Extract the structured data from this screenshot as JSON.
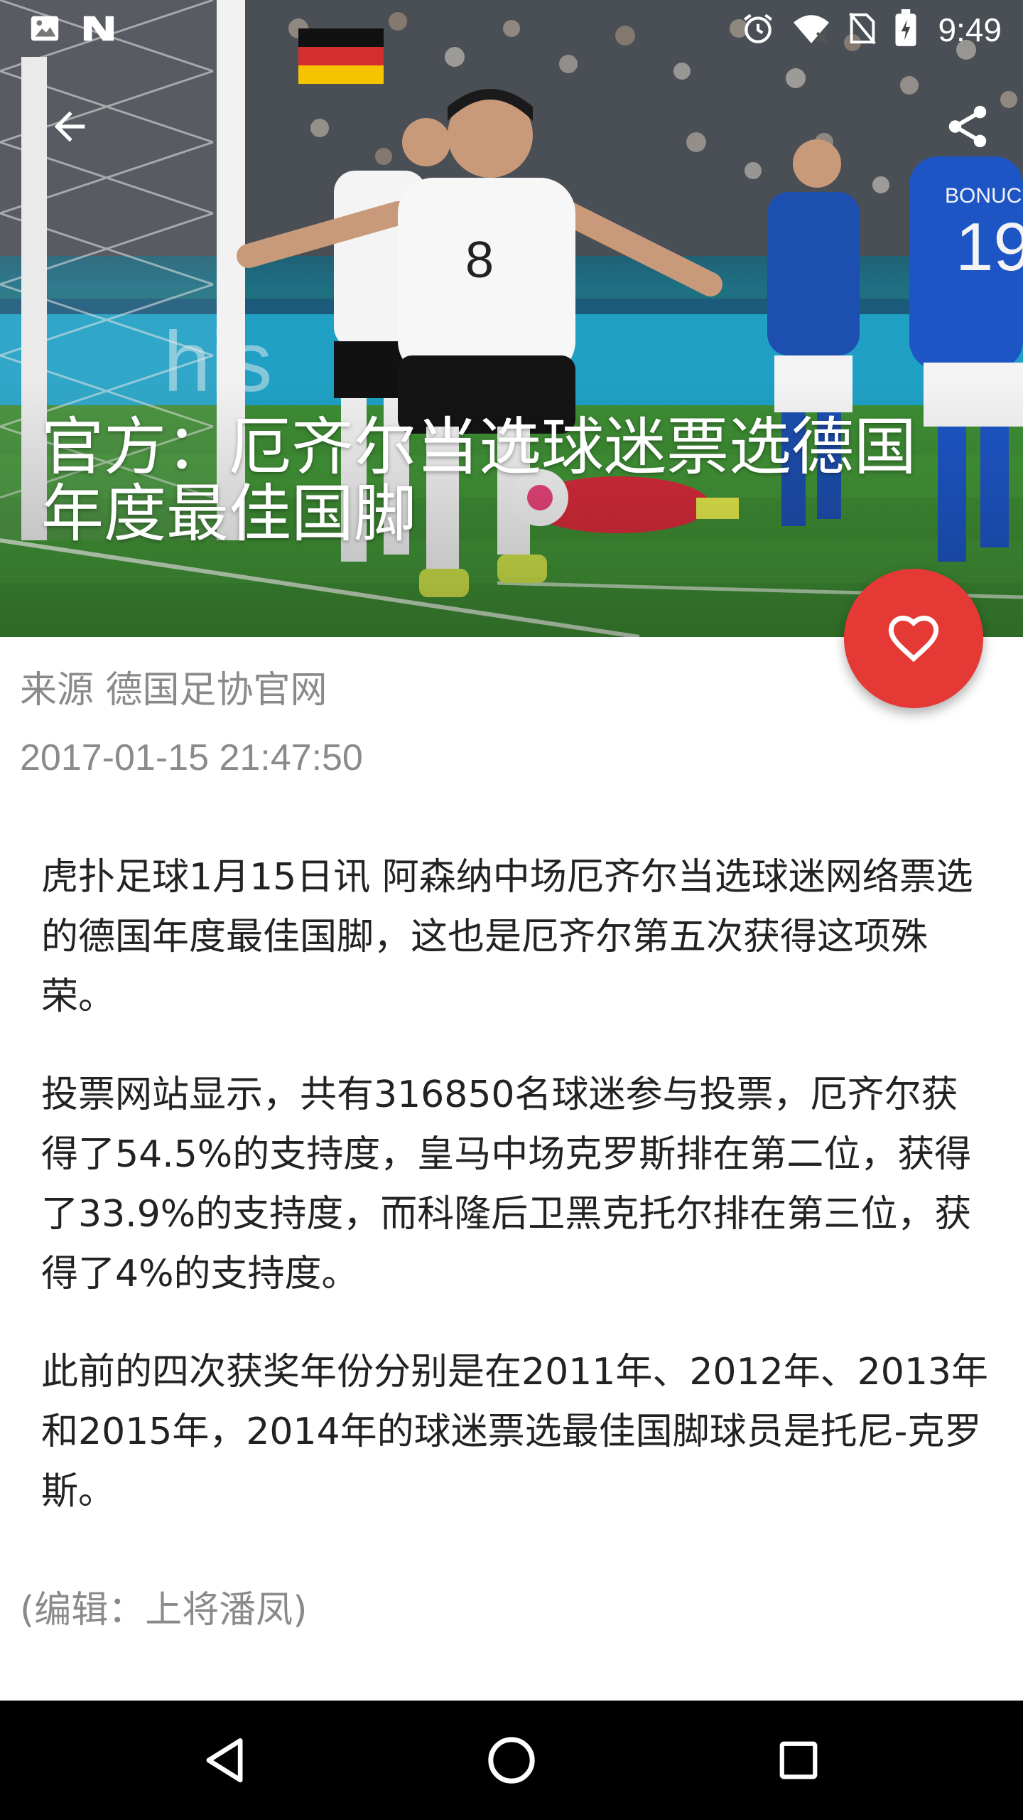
{
  "status_bar": {
    "time": "9:49",
    "left_icons": [
      "image-icon",
      "n-notification-icon"
    ],
    "right_icons": [
      "alarm-icon",
      "wifi-icon",
      "no-sim-icon",
      "battery-charging-icon"
    ]
  },
  "toolbar": {
    "back_icon": "arrow-back-icon",
    "share_icon": "share-icon"
  },
  "article": {
    "title": "官方：厄齐尔当选球迷票选德国年度最佳国脚",
    "source": "来源 德国足协官网",
    "datetime": "2017-01-15 21:47:50",
    "paragraphs": [
      "虎扑足球1月15日讯 阿森纳中场厄齐尔当选球迷网络票选的德国年度最佳国脚，这也是厄齐尔第五次获得这项殊荣。",
      "投票网站显示，共有316850名球迷参与投票，厄齐尔获得了54.5%的支持度，皇马中场克罗斯排在第二位，获得了33.9%的支持度，而科隆后卫黑克托尔排在第三位，获得了4%的支持度。",
      "此前的四次获奖年份分别是在2011年、2012年、2013年和2015年，2014年的球迷票选最佳国脚球员是托尼-克罗斯。"
    ],
    "editor": "(编辑：上将潘凤)"
  },
  "fab": {
    "icon": "heart-outline-icon",
    "color": "#e53935"
  },
  "photo_jersey": {
    "number_left": "8",
    "name_right": "BONUCCI",
    "number_right": "19"
  },
  "nav_bar": {
    "icons": [
      "nav-back-icon",
      "nav-home-icon",
      "nav-recents-icon"
    ]
  }
}
